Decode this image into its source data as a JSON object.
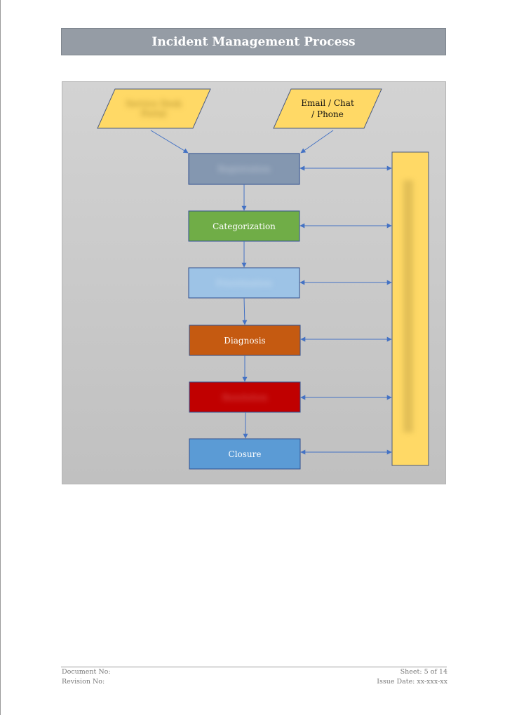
{
  "document": {
    "title": "Incident Management Process"
  },
  "diagram": {
    "inputs": [
      {
        "label": "Service Desk Portal",
        "obscured": true,
        "fill": "#ffd966"
      },
      {
        "label": "Email / Chat / Phone",
        "line1": "Email / Chat",
        "line2": "/ Phone",
        "obscured": false,
        "fill": "#ffd966"
      }
    ],
    "steps": [
      {
        "label": "Registration",
        "obscured": true,
        "fill": "#8497b0"
      },
      {
        "label": "Categorization",
        "obscured": false,
        "fill": "#70ad47"
      },
      {
        "label": "Prioritization",
        "obscured": true,
        "fill": "#9dc3e6"
      },
      {
        "label": "Diagnosis",
        "obscured": false,
        "fill": "#c55a11"
      },
      {
        "label": "Resolution",
        "obscured": true,
        "fill": "#c00000"
      },
      {
        "label": "Closure",
        "obscured": false,
        "fill": "#5b9bd5"
      }
    ],
    "side_bar": {
      "label": "Communication & Tracking",
      "obscured": true,
      "fill": "#ffd966"
    },
    "connector_color": "#4472c4"
  },
  "footer": {
    "document_no": "Document No:",
    "revision_no": "Revision No:",
    "sheet": "Sheet: 5 of 14",
    "issue_date": "Issue Date: xx-xxx-xx"
  }
}
